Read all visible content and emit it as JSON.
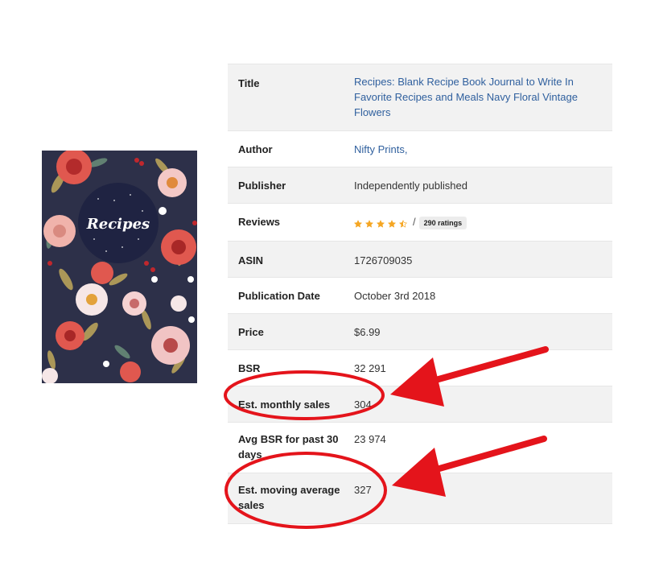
{
  "cover": {
    "title_text": "Recipes"
  },
  "details": [
    {
      "label": "Title",
      "value": "Recipes: Blank Recipe Book Journal to Write In Favorite Recipes and Meals Navy Floral Vintage Flowers",
      "link": true
    },
    {
      "label": "Author",
      "value": "Nifty Prints,",
      "link": true
    },
    {
      "label": "Publisher",
      "value": "Independently published",
      "link": false
    },
    {
      "label": "Reviews",
      "value": "/",
      "link": false
    },
    {
      "label": "ASIN",
      "value": "1726709035",
      "link": false
    },
    {
      "label": "Publication Date",
      "value": "October 3rd 2018",
      "link": false
    },
    {
      "label": "Price",
      "value": "$6.99",
      "link": false
    },
    {
      "label": "BSR",
      "value": "32 291",
      "link": false
    },
    {
      "label": "Est. monthly sales",
      "value": "304",
      "link": false
    },
    {
      "label": "Avg BSR for past 30 days",
      "value": "23 974",
      "link": false
    },
    {
      "label": "Est. moving average sales",
      "value": "327",
      "link": false
    }
  ],
  "reviews": {
    "rating": 4.5,
    "max": 5,
    "ratings_count": "290 ratings"
  },
  "colors": {
    "link": "#30609e",
    "star": "#f5a623",
    "annotation": "#e4141b",
    "row_alt": "#f2f2f2",
    "cover_bg": "#2d3049"
  }
}
